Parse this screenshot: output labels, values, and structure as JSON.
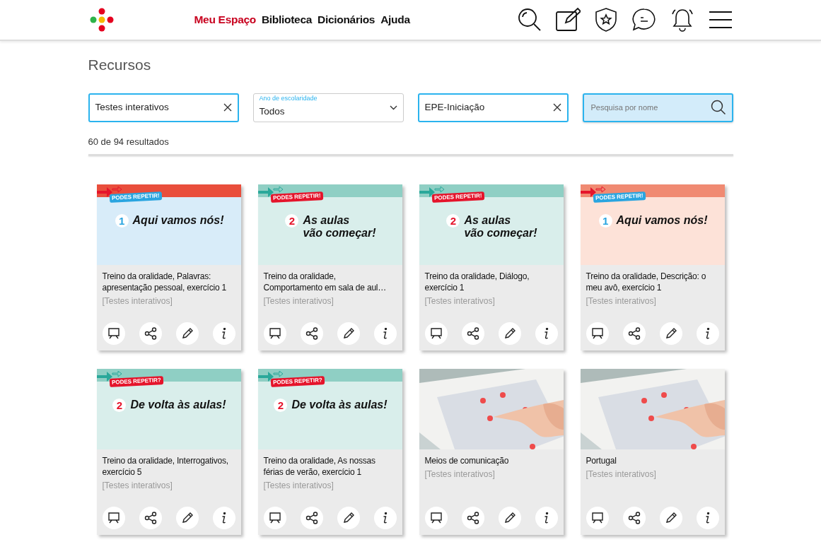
{
  "header": {
    "nav": [
      {
        "label": "Meu Espaço",
        "selected": true
      },
      {
        "label": "Biblioteca",
        "selected": false
      },
      {
        "label": "Dicionários",
        "selected": false
      },
      {
        "label": "Ajuda",
        "selected": false
      }
    ]
  },
  "page_title": "Recursos",
  "filters": [
    {
      "kind": "chip",
      "value": "Testes interativos"
    },
    {
      "kind": "select",
      "label": "Ano de escolaridade",
      "value": "Todos"
    },
    {
      "kind": "chip",
      "value": "EPE-Iniciação"
    },
    {
      "kind": "search",
      "placeholder": "Pesquisa por nome"
    }
  ],
  "result_count": "60 de 94 resultados",
  "resources": [
    {
      "title": "Treino da oralidade, Palavras: apresentação pessoal, exercício 1",
      "type": "[Testes interativos]",
      "cover": {
        "kind": "blue",
        "tag": "PODES REPETIR!",
        "number": "1",
        "heading": [
          "Aqui vamos nós!"
        ]
      }
    },
    {
      "title": "Treino da oralidade, Comportamento em sala de aul…",
      "type": "[Testes interativos]",
      "cover": {
        "kind": "teal",
        "tag": "PODES REPETIR!",
        "number": "2",
        "heading": [
          "As aulas",
          "vão começar!"
        ]
      }
    },
    {
      "title": "Treino da oralidade, Diálogo, exercício 1",
      "type": "[Testes interativos]",
      "cover": {
        "kind": "teal",
        "tag": "PODES REPETIR!",
        "number": "2",
        "heading": [
          "As aulas",
          "vão começar!"
        ]
      }
    },
    {
      "title": "Treino da oralidade, Descrição: o meu avô, exercício 1",
      "type": "[Testes interativos]",
      "cover": {
        "kind": "peach",
        "tag": "PODES REPETIR!",
        "number": "1",
        "heading": [
          "Aqui vamos nós!"
        ]
      }
    },
    {
      "title": "Treino da oralidade, Interrogativos, exercício 5",
      "type": "[Testes interativos]",
      "cover": {
        "kind": "teal",
        "tag": "PODES REPETIR?",
        "number": "2",
        "heading": [
          "De volta às aulas!"
        ]
      }
    },
    {
      "title": "Treino da oralidade, As nossas férias de verão, exercício 1",
      "type": "[Testes interativos]",
      "cover": {
        "kind": "teal",
        "tag": "PODES REPETIR?",
        "number": "2",
        "heading": [
          "De volta às aulas!"
        ]
      }
    },
    {
      "title": "Meios de comunicação",
      "type": "[Testes interativos]"
    },
    {
      "title": "Portugal",
      "type": "[Testes interativos]"
    }
  ]
}
